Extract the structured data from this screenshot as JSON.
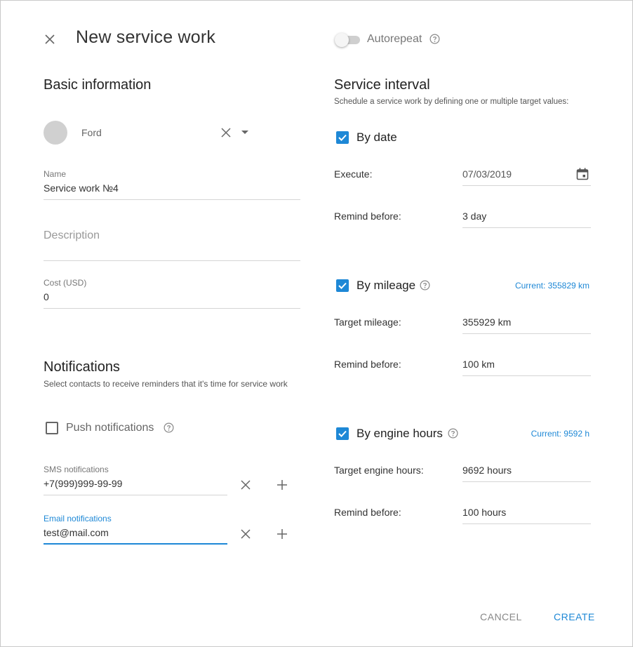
{
  "header": {
    "title": "New service work",
    "autorepeat_label": "Autorepeat"
  },
  "basic": {
    "title": "Basic information",
    "unit": "Ford",
    "name_label": "Name",
    "name_value": "Service work №4",
    "description_placeholder": "Description",
    "cost_label": "Cost (USD)",
    "cost_value": "0"
  },
  "notifications": {
    "title": "Notifications",
    "description": "Select contacts to receive reminders that it's time for service work",
    "push_label": "Push notifications",
    "push_checked": false,
    "sms_label": "SMS notifications",
    "sms_value": "+7(999)999-99-99",
    "email_label": "Email notifications",
    "email_value": "test@mail.com"
  },
  "interval": {
    "title": "Service interval",
    "description": "Schedule a service work by defining one or multiple target values:",
    "by_date": {
      "label": "By date",
      "checked": true,
      "execute_label": "Execute:",
      "execute_value": "07/03/2019",
      "remind_label": "Remind before:",
      "remind_value": "3 day"
    },
    "by_mileage": {
      "label": "By mileage",
      "checked": true,
      "current": "Current: 355829 km",
      "target_label": "Target mileage:",
      "target_value": "355929 km",
      "remind_label": "Remind before:",
      "remind_value": "100 km"
    },
    "by_engine_hours": {
      "label": "By engine hours",
      "checked": true,
      "current": "Current: 9592 h",
      "target_label": "Target engine hours:",
      "target_value": "9692 hours",
      "remind_label": "Remind before:",
      "remind_value": "100 hours"
    }
  },
  "footer": {
    "cancel_label": "CANCEL",
    "create_label": "CREATE"
  },
  "colors": {
    "accent": "#1e88d6",
    "text": "#333333",
    "muted": "#777777",
    "divider": "#d5d5d5"
  }
}
